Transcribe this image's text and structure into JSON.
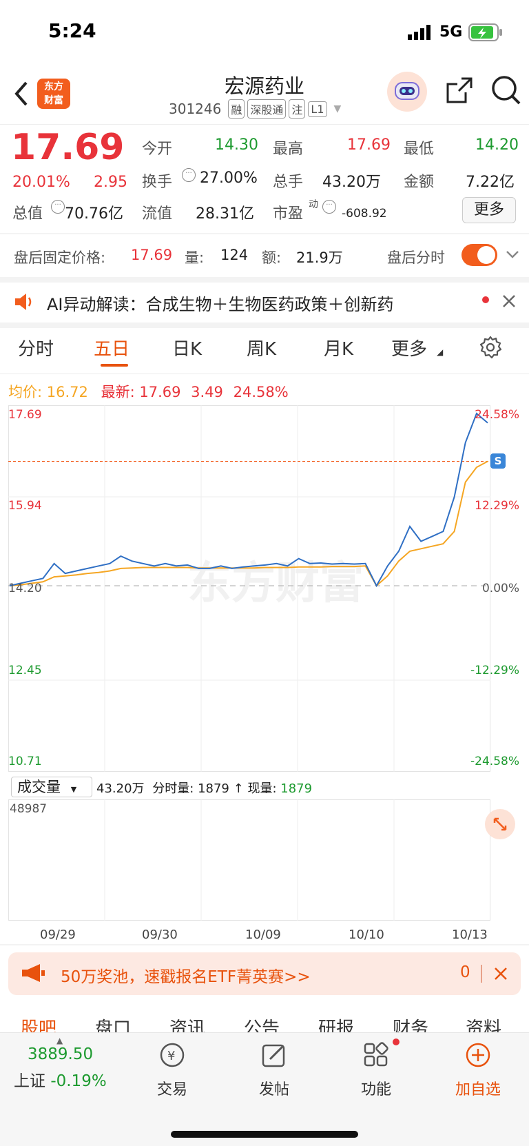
{
  "status": {
    "time": "5:24",
    "network": "5G"
  },
  "header": {
    "logo_line1": "东方",
    "logo_line2": "财富",
    "title": "宏源药业",
    "code": "301246",
    "tags": [
      "融",
      "深股通",
      "注",
      "L1"
    ]
  },
  "quote": {
    "price": "17.69",
    "change_pct": "20.01%",
    "change": "2.95",
    "open_label": "今开",
    "open": "14.30",
    "high_label": "最高",
    "high": "17.69",
    "low_label": "最低",
    "low": "14.20",
    "turnover_label": "换手",
    "turnover": "27.00%",
    "volume_label": "总手",
    "volume": "43.20万",
    "amount_label": "金额",
    "amount": "7.22亿",
    "mktcap_label": "总值",
    "mktcap": "70.76亿",
    "float_label": "流值",
    "float": "28.31亿",
    "pe_label": "市盈",
    "pe_sup": "动",
    "pe": "-608.92",
    "more": "更多"
  },
  "afterhours": {
    "label": "盘后固定价格:",
    "price": "17.69",
    "vol_label": "量:",
    "vol": "124",
    "amt_label": "额:",
    "amt": "21.9万",
    "toggle_label": "盘后分时"
  },
  "ai_banner": {
    "text": "AI异动解读：合成生物＋生物医药政策＋创新药"
  },
  "tabs": [
    "分时",
    "五日",
    "日K",
    "周K",
    "月K",
    "更多"
  ],
  "legend": {
    "avg_label": "均价:",
    "avg": "16.72",
    "latest_label": "最新:",
    "latest": "17.69",
    "chg": "3.49",
    "chg_pct": "24.58%"
  },
  "chart_data": {
    "type": "line",
    "y_left_ticks": [
      "17.69",
      "15.94",
      "14.20",
      "12.45",
      "10.71"
    ],
    "y_right_ticks": [
      "24.58%",
      "12.29%",
      "0.00%",
      "-12.29%",
      "-24.58%"
    ],
    "x_ticks": [
      "09/29",
      "09/30",
      "10/09",
      "10/10",
      "10/13"
    ],
    "ylim": [
      10.71,
      17.69
    ],
    "reference": 14.2,
    "series": [
      {
        "name": "price",
        "values": [
          14.2,
          14.25,
          14.3,
          14.35,
          14.65,
          14.45,
          14.5,
          14.55,
          14.6,
          14.65,
          14.8,
          14.7,
          14.65,
          14.6,
          14.65,
          14.6,
          14.62,
          14.55,
          14.55,
          14.6,
          14.55,
          14.58,
          14.6,
          14.62,
          14.65,
          14.6,
          14.75,
          14.65,
          14.66,
          14.64,
          14.65,
          14.64,
          14.65,
          14.2,
          14.6,
          14.9,
          15.4,
          15.1,
          15.2,
          15.3,
          16.0,
          17.1,
          17.69,
          17.5
        ]
      },
      {
        "name": "avg",
        "values": [
          14.2,
          14.22,
          14.25,
          14.28,
          14.38,
          14.4,
          14.42,
          14.45,
          14.47,
          14.5,
          14.55,
          14.56,
          14.57,
          14.57,
          14.57,
          14.57,
          14.57,
          14.56,
          14.56,
          14.56,
          14.56,
          14.56,
          14.56,
          14.57,
          14.57,
          14.57,
          14.58,
          14.58,
          14.58,
          14.59,
          14.59,
          14.59,
          14.6,
          14.2,
          14.4,
          14.7,
          14.9,
          14.95,
          15.0,
          15.05,
          15.3,
          16.3,
          16.6,
          16.72
        ]
      }
    ],
    "volume_label": "成交量",
    "volume_total": "43.20万",
    "volume_minute_label": "分时量:",
    "volume_minute": "1879",
    "volume_now_label": "现量:",
    "volume_now": "1879",
    "volume_max": "48987"
  },
  "promo": {
    "text": "50万奖池，速戳报名ETF菁英赛>>",
    "count": "0"
  },
  "lower_tabs": [
    "股吧",
    "盘口",
    "资讯",
    "公告",
    "研报",
    "财务",
    "资料"
  ],
  "bottom_nav": {
    "index_value": "3889.50",
    "index_name": "上证",
    "index_change": "-0.19%",
    "trade": "交易",
    "post": "发帖",
    "func": "功能",
    "add": "加自选"
  },
  "colors": {
    "accent": "#e8520d",
    "up": "#e8333a",
    "down": "#1d9a2f",
    "price_line": "#2f6fc4",
    "avg_line": "#f5a623"
  },
  "watermark": "东方财富"
}
